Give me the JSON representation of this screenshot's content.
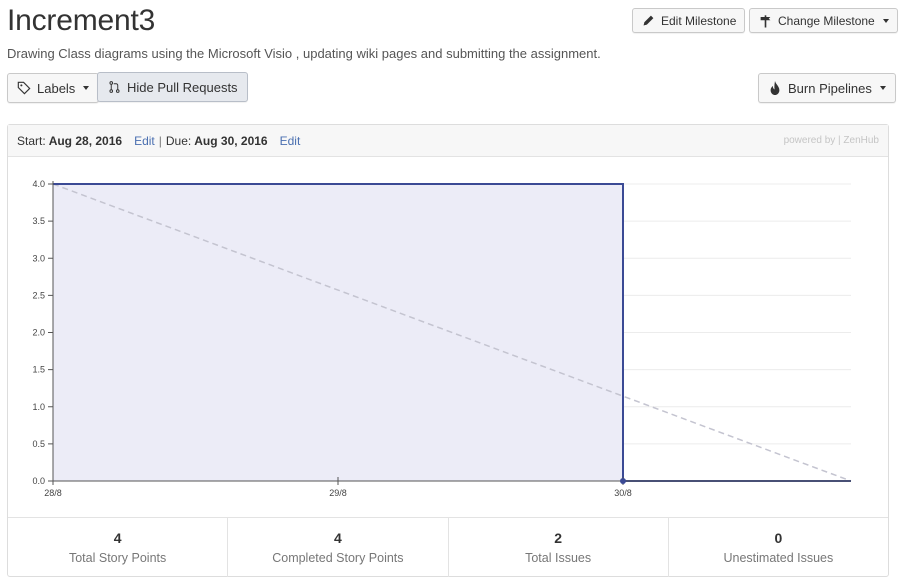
{
  "milestone": {
    "title": "Increment3",
    "description": "Drawing Class diagrams using the Microsoft Visio , updating wiki pages and submitting the assignment."
  },
  "toolbar": {
    "edit_milestone": "Edit Milestone",
    "change_milestone": "Change Milestone",
    "labels": "Labels",
    "hide_pull_requests": "Hide Pull Requests",
    "burn_pipelines": "Burn Pipelines"
  },
  "dates": {
    "start_label": "Start:",
    "start": "Aug 28, 2016",
    "edit1": "Edit",
    "separator": "|",
    "due_label": "Due:",
    "due": "Aug 30, 2016",
    "edit2": "Edit",
    "powered": "powered by | ZenHub"
  },
  "chart_data": {
    "type": "area",
    "x_ticks": [
      "28/8",
      "29/8",
      "30/8"
    ],
    "x_domain": [
      0,
      2.8
    ],
    "y_ticks": [
      "0.0",
      "0.5",
      "1.0",
      "1.5",
      "2.0",
      "2.5",
      "3.0",
      "3.5",
      "4.0"
    ],
    "ylim": [
      0,
      4
    ],
    "grid": true,
    "series": [
      {
        "points": [
          [
            0,
            4
          ],
          [
            2,
            4
          ],
          [
            2,
            0
          ],
          [
            2.8,
            0
          ]
        ],
        "color": "#3b4a95",
        "fill": "#ececf7"
      },
      {
        "points": [
          [
            0,
            4
          ],
          [
            2.8,
            0
          ]
        ],
        "color": "#c4c4d0",
        "dashed": true
      }
    ],
    "markers": [
      [
        2,
        0
      ]
    ]
  },
  "stats": [
    {
      "value": "4",
      "label": "Total Story Points"
    },
    {
      "value": "4",
      "label": "Completed Story Points"
    },
    {
      "value": "2",
      "label": "Total Issues"
    },
    {
      "value": "0",
      "label": "Unestimated Issues"
    }
  ]
}
